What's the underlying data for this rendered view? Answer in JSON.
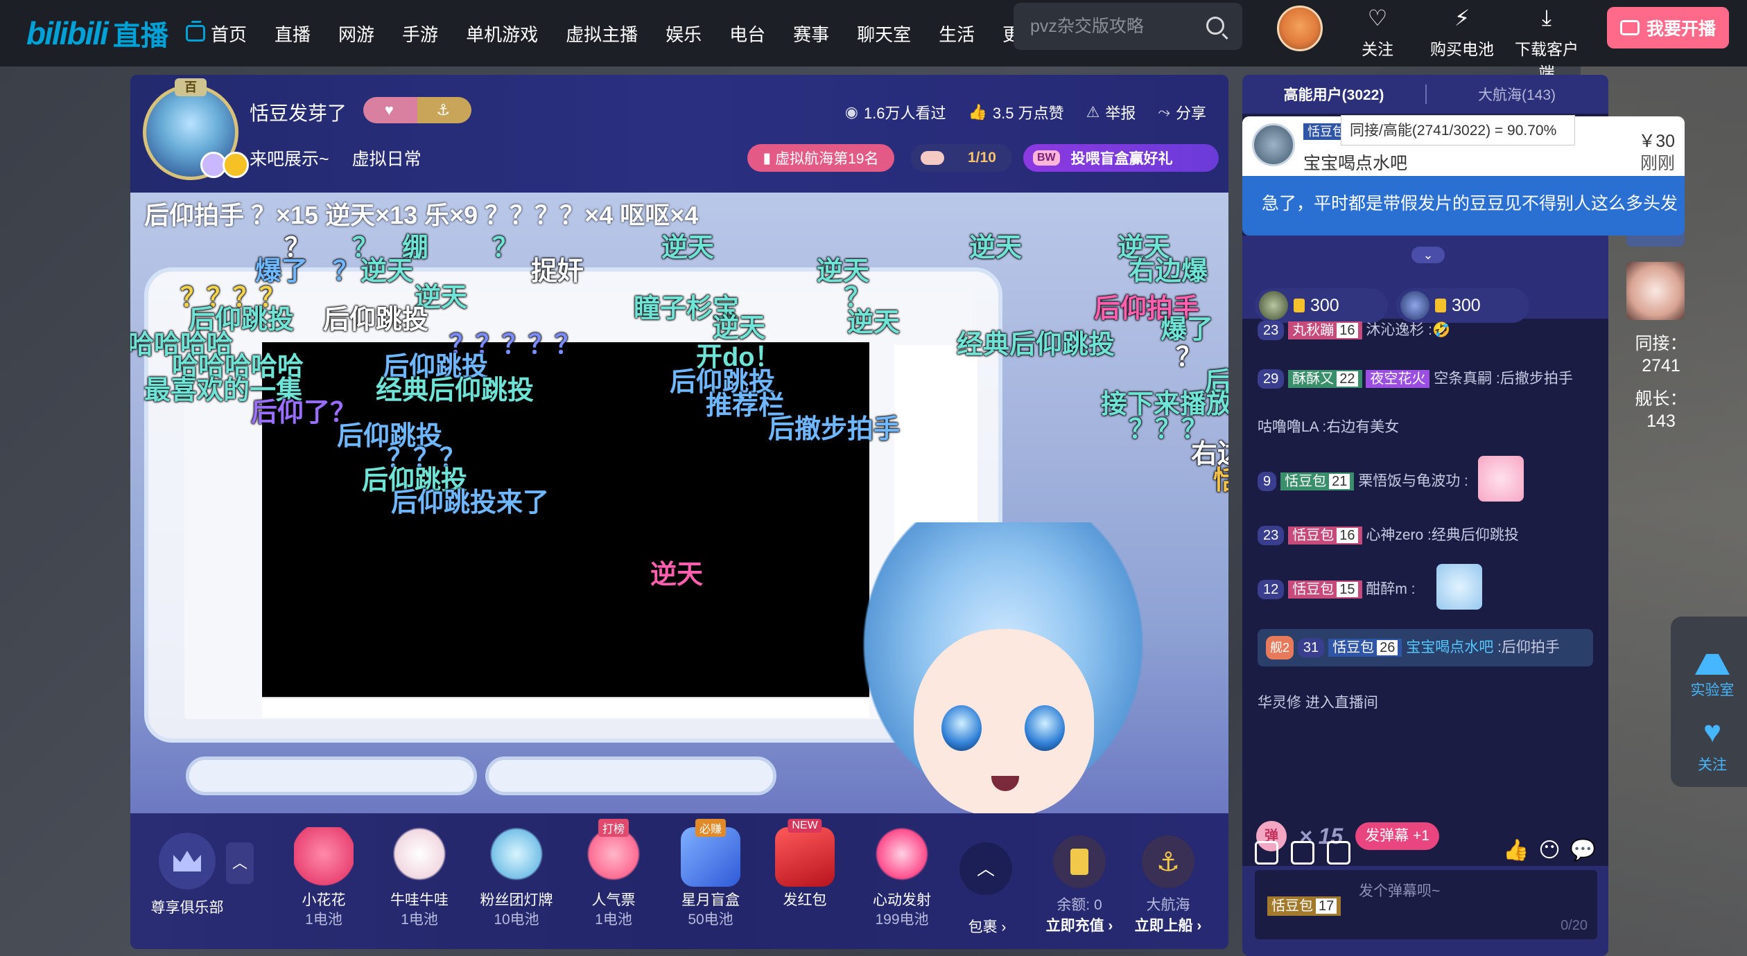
{
  "nav": {
    "logo_bili": "bilibili",
    "logo_live": "直播",
    "items": [
      "首页",
      "直播",
      "网游",
      "手游",
      "单机游戏",
      "虚拟主播",
      "娱乐",
      "电台",
      "赛事",
      "聊天室",
      "生活",
      "更多"
    ],
    "search_placeholder": "pvz杂交版攻略",
    "follow": "关注",
    "buy_battery": "购买电池",
    "download": "下载客户端",
    "go_live": "我要开播"
  },
  "anchor": {
    "name": "恬豆发芽了",
    "crown_label": "百",
    "subtitle_1": "来吧展示~",
    "subtitle_2": "虚拟日常",
    "viewers": "1.6万人看过",
    "likes": "3.5 万点赞",
    "report": "举报",
    "share": "分享",
    "rank_pill": "虚拟航海第19名",
    "blindbox_count": "1/10",
    "gift_pill": "投喂盲盒赢好礼",
    "gift_pill_badge": "BW"
  },
  "video": {
    "combo_line": "后仰拍手     ？×15   逆天×13   乐×9   ？？？？×4   呕呕×4",
    "danmaku": [
      {
        "text": "？",
        "color": "#ffffff"
      },
      {
        "text": "？",
        "color": "#6fe3d6"
      },
      {
        "text": "绷",
        "color": "#6fe3d6"
      },
      {
        "text": "？",
        "color": "#6fe3d6"
      },
      {
        "text": "逆天",
        "color": "#6fe3d6"
      },
      {
        "text": "逆天",
        "color": "#6fe3d6"
      },
      {
        "text": "逆天",
        "color": "#6fe3d6"
      },
      {
        "text": "爆了",
        "color": "#6fb7ff"
      },
      {
        "text": "？",
        "color": "#6fb7ff"
      },
      {
        "text": "逆天",
        "color": "#6fe3d6"
      },
      {
        "text": "捉奸",
        "color": "#ffffff"
      },
      {
        "text": "逆天",
        "color": "#6fe3d6"
      },
      {
        "text": "右边爆",
        "color": "#6fe3d6"
      },
      {
        "text": "？？？？",
        "color": "#f3d34a"
      },
      {
        "text": "逆天",
        "color": "#6fe3d6"
      },
      {
        "text": "？",
        "color": "#6fe3d6"
      },
      {
        "text": "瞳子杉宝",
        "color": "#6fe3d6"
      },
      {
        "text": "后仰拍手",
        "color": "#ff5fae"
      },
      {
        "text": "后仰跳投",
        "color": "#6fe3d6"
      },
      {
        "text": "后仰跳投",
        "color": "#ffffff"
      },
      {
        "text": "逆天",
        "color": "#6fe3d6"
      },
      {
        "text": "逆天",
        "color": "#6fe3d6"
      },
      {
        "text": "爆了",
        "color": "#6fe3d6"
      },
      {
        "text": "哈哈哈哈",
        "color": "#6fe3d6"
      },
      {
        "text": "？？？？？",
        "color": "#7a8cff"
      },
      {
        "text": "开do！",
        "color": "#6fe3d6"
      },
      {
        "text": "经典后仰跳投",
        "color": "#6fe3d6"
      },
      {
        "text": "？",
        "color": "#ffffff"
      },
      {
        "text": "哈哈哈哈哈",
        "color": "#6fe3d6"
      },
      {
        "text": "后仰跳投",
        "color": "#6fb7ff"
      },
      {
        "text": "后仰",
        "color": "#6fe3d6"
      },
      {
        "text": "最喜欢的一集",
        "color": "#6fe3d6"
      },
      {
        "text": "经典后仰跳投",
        "color": "#6fe3d6"
      },
      {
        "text": "后仰跳投",
        "color": "#6fb7ff"
      },
      {
        "text": "推荐栏",
        "color": "#6fb7ff"
      },
      {
        "text": "接下来播放",
        "color": "#6fe3d6"
      },
      {
        "text": "后仰了？",
        "color": "#9a6fff"
      },
      {
        "text": "后撤步拍手",
        "color": "#6fb7ff"
      },
      {
        "text": "？？？",
        "color": "#6fe3d6"
      },
      {
        "text": "后仰跳投",
        "color": "#6fb7ff"
      },
      {
        "text": "右边",
        "color": "#ffffff"
      },
      {
        "text": "？？？",
        "color": "#6fb7ff"
      },
      {
        "text": "恬",
        "color": "#f3c24a"
      },
      {
        "text": "后仰跳投",
        "color": "#6fe3d6"
      },
      {
        "text": "后仰跳投来了",
        "color": "#6fb7ff"
      },
      {
        "text": "逆天",
        "color": "#ff5fae"
      }
    ]
  },
  "gifts": {
    "club_label": "尊享俱乐部",
    "items": [
      {
        "name": "小花花",
        "price": "1电池",
        "tag": ""
      },
      {
        "name": "牛哇牛哇",
        "price": "1电池",
        "tag": ""
      },
      {
        "name": "粉丝团灯牌",
        "price": "10电池",
        "tag": ""
      },
      {
        "name": "人气票",
        "price": "1电池",
        "tag": "打榜"
      },
      {
        "name": "星月盲盒",
        "price": "50电池",
        "tag": "必赚"
      },
      {
        "name": "发红包",
        "price": "",
        "tag": "NEW"
      },
      {
        "name": "心动发射",
        "price": "199电池",
        "tag": ""
      }
    ],
    "more_label": "包裹 ›",
    "balance_label": "余额: 0",
    "recharge_label": "立即充值 ›",
    "voyage_label": "大航海",
    "board_label": "立即上船 ›"
  },
  "right": {
    "tab_high": "高能用户(3022)",
    "tab_voyage": "大航海(143)",
    "tooltip": "同接/高能(2741/3022) = 90.70%",
    "sc": {
      "badge": "恬豆包",
      "user": "宝宝喝点水吧",
      "price": "￥30",
      "time": "刚刚",
      "text": "急了，平时都是带假发片的豆豆见不得别人这么多头发"
    },
    "rank_chip_1": "300",
    "rank_chip_2": "300",
    "messages": [
      {
        "lv": "23",
        "fan": "丸秋蹦",
        "fan_lv": "16",
        "text": "沐沁逸杉 :🤣"
      },
      {
        "lv": "29",
        "fan": "酥酥又",
        "fan_lv": "22",
        "fan2": "夜空花火",
        "text": "空条真嗣 :后撤步拍手"
      },
      {
        "text": "咕噜噜LA :右边有美女"
      },
      {
        "lv": "9",
        "fan": "恬豆包",
        "fan_lv": "21",
        "text": "栗悟饭与龟波功 :"
      },
      {
        "lv": "23",
        "fan": "恬豆包",
        "fan_lv": "16",
        "text": "心神zero :经典后仰跳投"
      },
      {
        "lv": "12",
        "fan": "恬豆包",
        "fan_lv": "15",
        "text": "酣醉m :"
      }
    ],
    "highlight": {
      "guard": "舰2",
      "lv": "31",
      "fan": "恬豆包",
      "fan_lv": "26",
      "user": "宝宝喝点水吧",
      "text": " :后仰拍手"
    },
    "enter_msg": "华灵修 进入直播间",
    "combo_dan": "弹",
    "combo_count": "× 15",
    "combo_send": "发弹幕 +1",
    "input_fan": "恬豆包",
    "input_fan_lv": "17",
    "input_placeholder": "发个弹幕呗~",
    "input_count": "0/20"
  },
  "far_right": {
    "concurrent_label": "同接：",
    "concurrent_value": "2741",
    "captain_label": "舰长：",
    "captain_value": "143",
    "lab": "实验室",
    "follow": "关注"
  }
}
